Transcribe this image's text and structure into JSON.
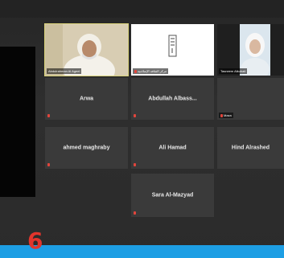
{
  "participants": [
    {
      "id": "p1",
      "label": "Abdulrahman Al Ageel",
      "kind": "video"
    },
    {
      "id": "p2",
      "label": "مركز الثقافة الإسلامية",
      "kind": "video"
    },
    {
      "id": "p3",
      "label": "Tasneem Alkubati",
      "kind": "video"
    },
    {
      "id": "p4",
      "name": "Arwa",
      "kind": "name"
    },
    {
      "id": "p5",
      "name": "Abdullah  Albass...",
      "kind": "name"
    },
    {
      "id": "p6",
      "label": "Maza",
      "kind": "name"
    },
    {
      "id": "p7",
      "name": "ahmed maghraby",
      "kind": "name"
    },
    {
      "id": "p8",
      "name": "Ali Hamad",
      "kind": "name"
    },
    {
      "id": "p9",
      "name": "Hind Alrashed",
      "kind": "name"
    },
    {
      "id": "p10",
      "name": "Sara Al-Mazyad",
      "kind": "name"
    }
  ],
  "overlay": {
    "number": "6"
  },
  "colors": {
    "accent_bar": "#1d9ee4",
    "number": "#e2352c",
    "tile": "#3a3a3a",
    "muted_mic": "#e2453c"
  }
}
